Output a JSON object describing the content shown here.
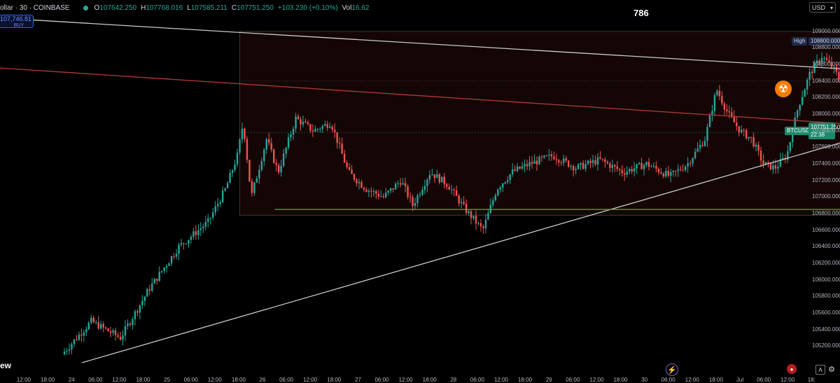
{
  "header": {
    "symbol": "ollar · 30 · COINBASE",
    "o_label": "O",
    "o_value": "107642.250",
    "h_label": "H",
    "h_value": "107768.016",
    "l_label": "L",
    "l_value": "107585.211",
    "c_label": "C",
    "c_value": "107751.250",
    "change": "+103.230 (+0.10%)",
    "vol_label": "Vol",
    "vol_value": "16.62"
  },
  "buy_box": {
    "price": "107,746.81",
    "label": "BUY"
  },
  "currency": "USD",
  "annotation_786": "786",
  "high_tag": {
    "label": "High",
    "value": "108800.000"
  },
  "symbol_tag": "BTCUSD",
  "price_tag": {
    "value": "107751.250",
    "countdown": "22:38"
  },
  "logo_fragment": "ew",
  "reset_button": "A",
  "colors": {
    "up": "#26a69a",
    "down": "#ef5350",
    "background": "#000000",
    "accent": "#2962ff"
  },
  "icons": [
    "radiation-icon",
    "lightning-icon",
    "flag-icon",
    "gear-icon"
  ],
  "chart_data": {
    "type": "candlestick",
    "ylim": [
      105000,
      109100
    ],
    "y_ticks": [
      "109000.000",
      "108800.000",
      "108600.000",
      "108400.000",
      "108200.000",
      "108000.000",
      "107800.000",
      "107600.000",
      "107400.000",
      "107200.000",
      "107000.000",
      "106800.000",
      "106600.000",
      "106400.000",
      "106200.000",
      "106000.000",
      "105800.000",
      "105600.000",
      "105400.000",
      "105200.000"
    ],
    "x_ticks": [
      "12:00",
      "18:00",
      "24",
      "06:00",
      "12:00",
      "18:00",
      "25",
      "06:00",
      "12:00",
      "18:00",
      "26",
      "06:00",
      "12:00",
      "18:00",
      "27",
      "06:00",
      "12:00",
      "18:00",
      "28",
      "06:00",
      "12:00",
      "18:00",
      "29",
      "06:00",
      "12:00",
      "18:00",
      "30",
      "06:00",
      "12:00",
      "18:00",
      "Jul",
      "06:00",
      "12:00",
      "18:"
    ],
    "price_path": [
      [
        24.0,
        105100
      ],
      [
        24.25,
        105500
      ],
      [
        24.5,
        105300
      ],
      [
        24.75,
        105900
      ],
      [
        25.0,
        106400
      ],
      [
        25.25,
        106700
      ],
      [
        25.4,
        107100
      ],
      [
        25.5,
        107500
      ],
      [
        25.55,
        107900
      ],
      [
        25.62,
        107000
      ],
      [
        25.75,
        107700
      ],
      [
        25.85,
        107300
      ],
      [
        26.0,
        107950
      ],
      [
        26.15,
        107800
      ],
      [
        26.3,
        107900
      ],
      [
        26.45,
        107300
      ],
      [
        26.6,
        107100
      ],
      [
        26.75,
        107000
      ],
      [
        26.9,
        107200
      ],
      [
        27.0,
        106900
      ],
      [
        27.15,
        107300
      ],
      [
        27.3,
        107150
      ],
      [
        27.45,
        106850
      ],
      [
        27.6,
        106600
      ],
      [
        27.72,
        107100
      ],
      [
        27.85,
        107300
      ],
      [
        28.0,
        107400
      ],
      [
        28.2,
        107500
      ],
      [
        28.4,
        107350
      ],
      [
        28.6,
        107450
      ],
      [
        28.8,
        107300
      ],
      [
        29.0,
        107400
      ],
      [
        29.2,
        107250
      ],
      [
        29.35,
        107400
      ],
      [
        29.5,
        107700
      ],
      [
        29.6,
        108300
      ],
      [
        29.7,
        108000
      ],
      [
        29.8,
        107800
      ],
      [
        29.9,
        107700
      ],
      [
        30.0,
        107400
      ],
      [
        30.1,
        107350
      ],
      [
        30.2,
        107500
      ],
      [
        30.3,
        108100
      ],
      [
        30.4,
        108500
      ],
      [
        30.5,
        108700
      ],
      [
        30.6,
        108550
      ],
      [
        30.7,
        108300
      ],
      [
        30.8,
        107900
      ],
      [
        30.9,
        107600
      ],
      [
        30.95,
        107751.25
      ]
    ],
    "lines": [
      {
        "kind": "descending-resistance",
        "color": "#c8c8c8",
        "from": [
          23.0,
          109200
        ],
        "to": [
          31.8,
          108450
        ]
      },
      {
        "kind": "descending-red",
        "color": "#b23a3a",
        "from": [
          23.0,
          108600
        ],
        "to": [
          31.8,
          107780
        ]
      },
      {
        "kind": "ascending-support",
        "color": "#c8c8c8",
        "from": [
          24.15,
          105000
        ],
        "to": [
          31.8,
          108130
        ]
      },
      {
        "kind": "horizontal-support",
        "color": "#4caf50",
        "from": [
          25.8,
          106850
        ],
        "to": [
          31.8,
          106850
        ]
      }
    ],
    "range_box": {
      "from": [
        25.5,
        109000
      ],
      "to": [
        31.8,
        106780
      ]
    },
    "dotted_levels": [
      108400,
      107780
    ]
  }
}
